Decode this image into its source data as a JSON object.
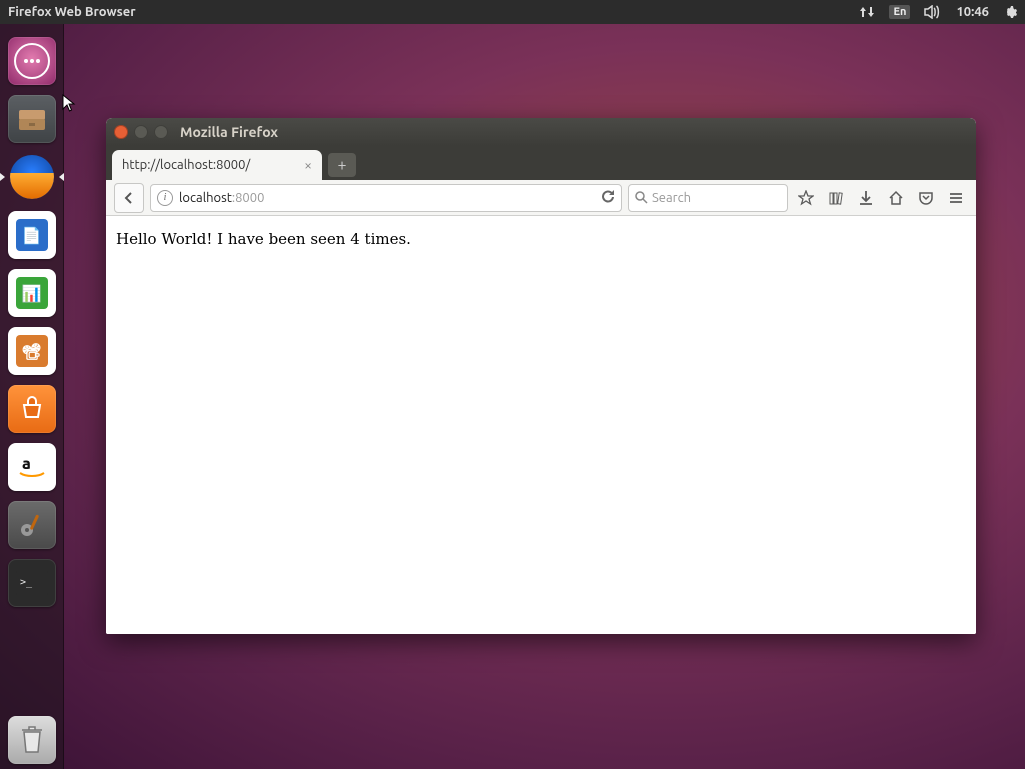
{
  "menubar": {
    "app_title": "Firefox Web Browser",
    "ime": "En",
    "clock": "10:46"
  },
  "launcher": {
    "items": [
      {
        "name": "dash",
        "label": "Dash"
      },
      {
        "name": "files",
        "label": "Files"
      },
      {
        "name": "firefox",
        "label": "Firefox"
      },
      {
        "name": "writer",
        "label": "LibreOffice Writer"
      },
      {
        "name": "calc",
        "label": "LibreOffice Calc"
      },
      {
        "name": "impress",
        "label": "LibreOffice Impress"
      },
      {
        "name": "software",
        "label": "Ubuntu Software"
      },
      {
        "name": "amazon",
        "label": "Amazon"
      },
      {
        "name": "settings",
        "label": "System Settings"
      },
      {
        "name": "terminal",
        "label": "Terminal"
      }
    ],
    "trash_label": "Trash"
  },
  "window": {
    "title": "Mozilla Firefox",
    "tab": {
      "title": "http://localhost:8000/"
    },
    "url": {
      "host": "localhost",
      "port": ":8000",
      "identity": "i"
    },
    "search_placeholder": "Search",
    "page_text": "Hello World! I have been seen 4 times."
  }
}
